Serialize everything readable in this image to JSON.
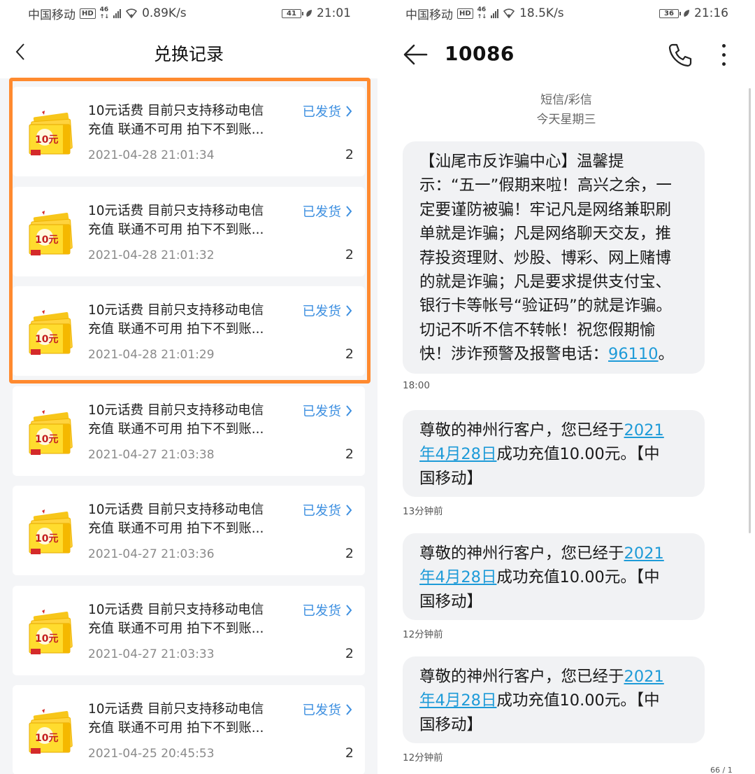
{
  "left": {
    "status": {
      "carrier": "中国移动",
      "hd": "HD",
      "net": "46",
      "speed": "0.89K/s",
      "battery": "41",
      "time": "21:01"
    },
    "title": "兑换记录",
    "orders": [
      {
        "title_line1": "10元话费 目前只支持移动电信",
        "title_line2": "充值 联通不可用 拍下不到账...",
        "time": "2021-04-28 21:01:34",
        "status": "已发货",
        "qty": "2",
        "coupon_text": "10元"
      },
      {
        "title_line1": "10元话费 目前只支持移动电信",
        "title_line2": "充值 联通不可用 拍下不到账...",
        "time": "2021-04-28 21:01:32",
        "status": "已发货",
        "qty": "2",
        "coupon_text": "10元"
      },
      {
        "title_line1": "10元话费 目前只支持移动电信",
        "title_line2": "充值 联通不可用 拍下不到账...",
        "time": "2021-04-28 21:01:29",
        "status": "已发货",
        "qty": "2",
        "coupon_text": "10元"
      },
      {
        "title_line1": "10元话费 目前只支持移动电信",
        "title_line2": "充值 联通不可用 拍下不到账...",
        "time": "2021-04-27 21:03:38",
        "status": "已发货",
        "qty": "2",
        "coupon_text": "10元"
      },
      {
        "title_line1": "10元话费 目前只支持移动电信",
        "title_line2": "充值 联通不可用 拍下不到账...",
        "time": "2021-04-27 21:03:36",
        "status": "已发货",
        "qty": "2",
        "coupon_text": "10元"
      },
      {
        "title_line1": "10元话费 目前只支持移动电信",
        "title_line2": "充值 联通不可用 拍下不到账...",
        "time": "2021-04-27 21:03:33",
        "status": "已发货",
        "qty": "2",
        "coupon_text": "10元"
      },
      {
        "title_line1": "10元话费 目前只支持移动电信",
        "title_line2": "充值 联通不可用 拍下不到账...",
        "time": "2021-04-25 20:45:53",
        "status": "已发货",
        "qty": "2",
        "coupon_text": "10元"
      }
    ],
    "highlight_color": "#ff8a2f",
    "status_color": "#3d8fe0"
  },
  "right": {
    "status": {
      "carrier": "中国移动",
      "hd": "HD",
      "net": "46",
      "speed": "18.5K/s",
      "battery": "36",
      "time": "21:16"
    },
    "contact": "10086",
    "conv_type": "短信/彩信",
    "conv_day": "今天星期三",
    "messages": [
      {
        "lines": [
          "【汕尾市反诈骗中心】温馨提",
          "示：“五一”假期来啦！高兴之余，一",
          "定要谨防被骗！牢记凡是网络兼职刷",
          "单就是诈骗；凡是网络聊天交友，推",
          "荐投资理财、炒股、博彩、网上赌博",
          "的就是诈骗；凡是要求提供支付宝、",
          "银行卡等帐号“验证码”的就是诈骗。",
          "切记不听不信不转帐！祝您假期愉"
        ],
        "last_prefix": "快！涉诈预警及报警电话：",
        "last_link": "96110",
        "last_suffix": "。",
        "time": "18:00"
      },
      {
        "l1_text": "尊敬的神州行客户，您已经于",
        "l1_link": "2021",
        "l2_link": "年4月28日",
        "l2_text": "成功充值10.00元。【中",
        "l3_text": "国移动】",
        "time": "13分钟前"
      },
      {
        "l1_text": "尊敬的神州行客户，您已经于",
        "l1_link": "2021",
        "l2_link": "年4月28日",
        "l2_text": "成功充值10.00元。【中",
        "l3_text": "国移动】",
        "time": "12分钟前"
      },
      {
        "l1_text": "尊敬的神州行客户，您已经于",
        "l1_link": "2021",
        "l2_link": "年4月28日",
        "l2_text": "成功充值10.00元。【中",
        "l3_text": "国移动】",
        "time": "12分钟前"
      }
    ],
    "page_counter": "66 / 1",
    "link_color": "#1e9bd8"
  }
}
